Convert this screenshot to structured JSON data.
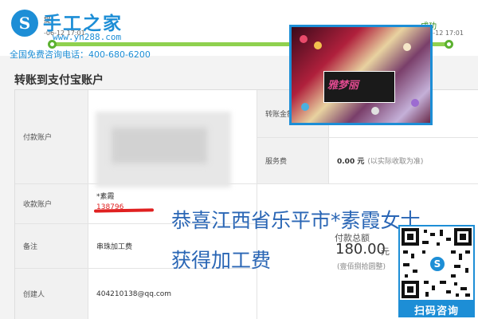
{
  "brand": {
    "logo_glyph": "S",
    "name": "手工之家",
    "url": "www.yn288.com",
    "phone": "全国免费咨询电话：400-680-6200",
    "color": "#1d8ed6"
  },
  "progress": {
    "left_label": "提",
    "left_date": "-06-12 17:01",
    "right_label": "成功",
    "right_date": "20-06-12 17:01",
    "line_color": "#8fd14f"
  },
  "page_title": "转账到支付宝账户",
  "table": {
    "rows": [
      {
        "label": "付款账户",
        "value": ""
      },
      {
        "label": "收款账户",
        "value": "*素霞"
      },
      {
        "label": "备注",
        "value": "串珠加工费"
      },
      {
        "label": "创建人",
        "value": "404210138@qq.com"
      }
    ],
    "right": [
      {
        "label": "转账金额",
        "value": ""
      },
      {
        "label": "服务费",
        "value": "0.00 元",
        "note": "(以实际收取为准)"
      }
    ],
    "receiver_account_partial": "138796",
    "total_label": "付款总额",
    "total_value": "180.00",
    "total_unit": "元",
    "total_cn": "(壹佰捌拾圆整)"
  },
  "photo": {
    "brand_text": "雅梦丽"
  },
  "caption": {
    "line1": "恭喜江西省乐平市*素霞女士",
    "line2": "获得加工费"
  },
  "qr": {
    "center_glyph": "S",
    "label": "扫码咨询"
  }
}
